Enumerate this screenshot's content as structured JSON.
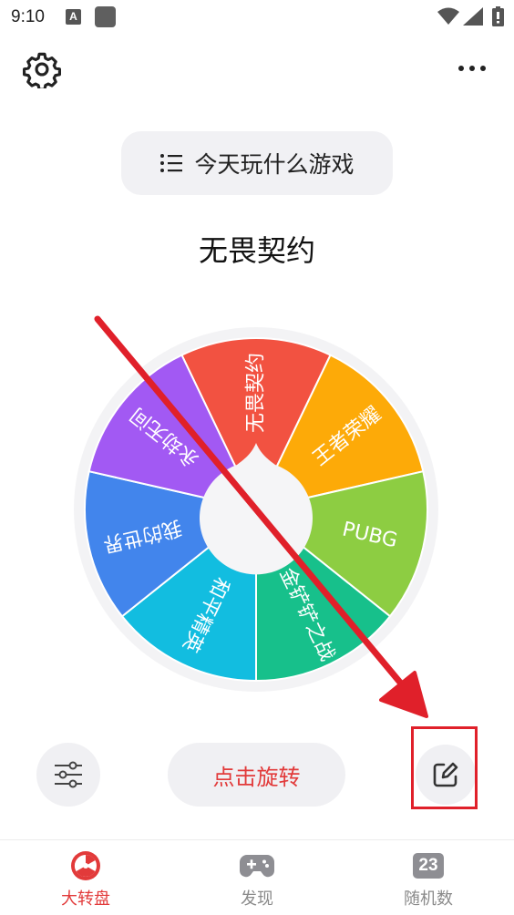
{
  "status_bar": {
    "time": "9:10",
    "notif_letter": "A"
  },
  "header": {
    "settings_icon": "gear-icon",
    "more_icon": "more-horizontal-icon"
  },
  "list_button": {
    "label": "今天玩什么游戏",
    "icon": "list-icon"
  },
  "result": {
    "title": "无畏契约"
  },
  "wheel": {
    "segments": [
      {
        "label": "无畏契约",
        "color": "#f25241"
      },
      {
        "label": "王者荣耀",
        "color": "#fdaa08"
      },
      {
        "label": "PUBG",
        "color": "#8dcd42"
      },
      {
        "label": "金铲铲之战",
        "color": "#17c08b"
      },
      {
        "label": "和平精英",
        "color": "#12bde0"
      },
      {
        "label": "我的世界",
        "color": "#4285ec"
      },
      {
        "label": "永劫无间",
        "color": "#a259f3"
      }
    ],
    "pointer_color": "#f5f5f7",
    "border_color": "#f3f3f5"
  },
  "controls": {
    "spin_label": "点击旋转",
    "filter_icon": "sliders-icon",
    "edit_icon": "edit-icon"
  },
  "tabs": [
    {
      "label": "大转盘",
      "icon": "wheel-icon",
      "active": true
    },
    {
      "label": "发现",
      "icon": "gamepad-icon",
      "active": false
    },
    {
      "label": "随机数",
      "icon": "calendar-number-icon",
      "icon_text": "23",
      "active": false
    }
  ],
  "colors": {
    "accent": "#e23a3a",
    "annotation": "#e0202a"
  }
}
